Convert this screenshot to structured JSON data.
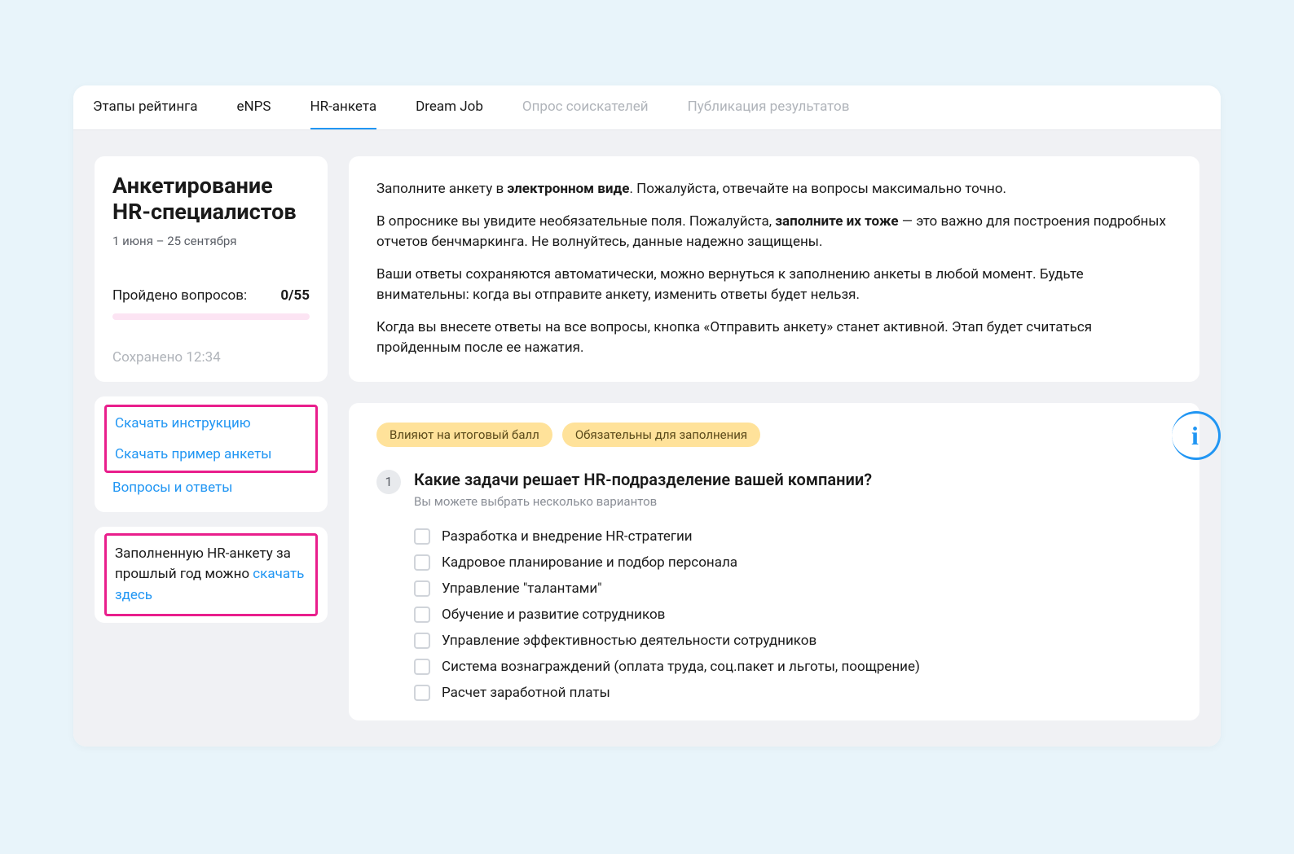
{
  "tabs": [
    {
      "label": "Этапы рейтинга",
      "state": "normal"
    },
    {
      "label": "eNPS",
      "state": "normal"
    },
    {
      "label": "HR-анкета",
      "state": "active"
    },
    {
      "label": "Dream Job",
      "state": "normal"
    },
    {
      "label": "Опрос соискателей",
      "state": "disabled"
    },
    {
      "label": "Публикация результатов",
      "state": "disabled"
    }
  ],
  "sidebar": {
    "title": "Анкетирование HR-специалистов",
    "dates": "1 июня – 25 сентября",
    "progress_label": "Пройдено вопросов:",
    "progress_count": "0/55",
    "saved": "Сохранено 12:34",
    "links": {
      "download_instruction": "Скачать инструкцию",
      "download_example": "Скачать пример анкеты",
      "faq": "Вопросы и ответы"
    },
    "prev_year_prefix": "Заполненную HR-анкету за прошлый год можно ",
    "prev_year_link": "скачать здесь"
  },
  "info": {
    "p1_prefix": "Заполните анкету в ",
    "p1_bold": "электронном виде",
    "p1_suffix": ". Пожалуйста, отвечайте на вопросы максимально точно.",
    "p2_prefix": "В опроснике вы увидите необязательные поля. Пожалуйста, ",
    "p2_bold": "заполните их тоже",
    "p2_suffix": " — это важно для построения подробных отчетов бенчмаркинга. Не волнуйтесь, данные надежно защищены.",
    "p3": "Ваши ответы сохраняются автоматически, можно вернуться к заполнению анкеты в любой момент. Будьте внимательны: когда вы отправите анкету, изменить ответы будет нельзя.",
    "p4": "Когда вы внесете ответы на все вопросы, кнопка «Отправить анкету» станет активной. Этап будет считаться пройденным после ее нажатия."
  },
  "question": {
    "badges": [
      "Влияют на итоговый балл",
      "Обязательны для заполнения"
    ],
    "number": "1",
    "title": "Какие задачи решает HR-подразделение вашей компании?",
    "hint": "Вы можете выбрать несколько вариантов",
    "options": [
      "Разработка и внедрение HR-стратегии",
      "Кадровое планирование и подбор персонала",
      "Управление \"талантами\"",
      "Обучение и развитие сотрудников",
      "Управление эффективностью деятельности сотрудников",
      "Система вознаграждений (оплата труда, соц.пакет и льготы, поощрение)",
      "Расчет заработной платы"
    ]
  },
  "info_icon": "i"
}
